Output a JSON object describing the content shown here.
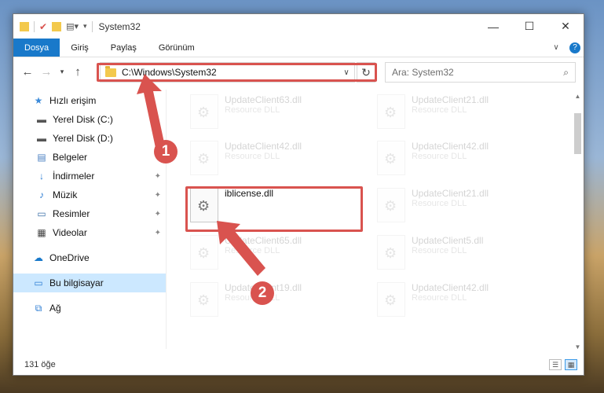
{
  "window": {
    "title": "System32"
  },
  "ribbon": {
    "tabs": [
      "Dosya",
      "Giriş",
      "Paylaş",
      "Görünüm"
    ]
  },
  "address": {
    "path": "C:\\Windows\\System32"
  },
  "search": {
    "placeholder": "Ara: System32"
  },
  "sidebar": {
    "items": [
      {
        "label": "Hızlı erişim",
        "icon": "star-icon"
      },
      {
        "label": "Yerel Disk (C:)",
        "icon": "drive-icon"
      },
      {
        "label": "Yerel Disk (D:)",
        "icon": "drive-icon"
      },
      {
        "label": "Belgeler",
        "icon": "document-icon"
      },
      {
        "label": "İndirmeler",
        "icon": "download-icon"
      },
      {
        "label": "Müzik",
        "icon": "music-icon"
      },
      {
        "label": "Resimler",
        "icon": "picture-icon"
      },
      {
        "label": "Videolar",
        "icon": "video-icon"
      },
      {
        "label": "OneDrive",
        "icon": "cloud-icon"
      },
      {
        "label": "Bu bilgisayar",
        "icon": "computer-icon"
      },
      {
        "label": "Ağ",
        "icon": "network-icon"
      }
    ]
  },
  "files": [
    {
      "name": "UpdateClient63.dll",
      "desc": "Resource DLL"
    },
    {
      "name": "UpdateClient21.dll",
      "desc": "Resource DLL"
    },
    {
      "name": "UpdateClient42.dll",
      "desc": "Resource DLL"
    },
    {
      "name": "UpdateClient42.dll",
      "desc": "Resource DLL"
    },
    {
      "name": "iblicense.dll",
      "desc": ""
    },
    {
      "name": "UpdateClient21.dll",
      "desc": "Resource DLL"
    },
    {
      "name": "UpdateClient65.dll",
      "desc": "Resource DLL"
    },
    {
      "name": "UpdateClient5.dll",
      "desc": "Resource DLL"
    },
    {
      "name": "UpdateClient19.dll",
      "desc": "Resource DLL"
    },
    {
      "name": "UpdateClient42.dll",
      "desc": "Resource DLL"
    }
  ],
  "status": {
    "count": "131 öğe"
  },
  "annotations": {
    "badge1": "1",
    "badge2": "2"
  },
  "colors": {
    "accent": "#1979ca",
    "highlight": "#d9534f",
    "selected": "#cce8ff"
  }
}
